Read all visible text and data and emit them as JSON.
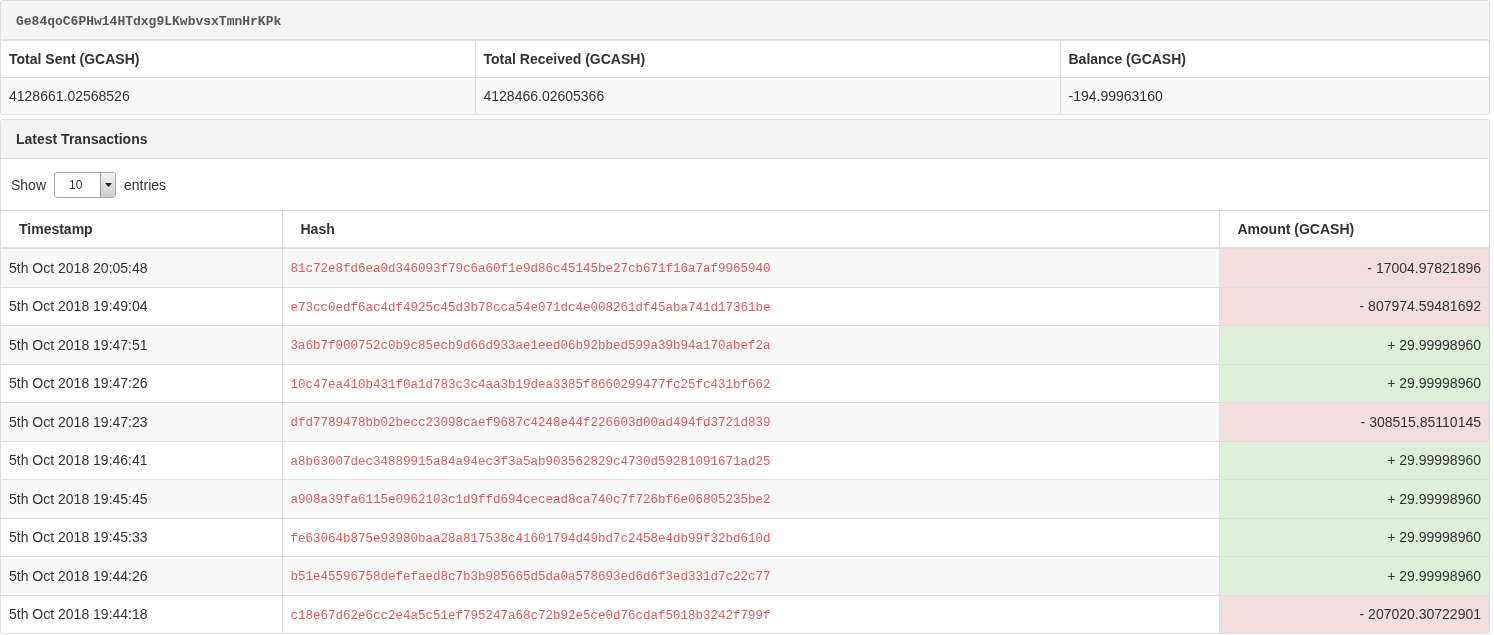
{
  "address": "Ge84qoC6PHw14HTdxg9LKwbvsxTmnHrKPk",
  "summary": {
    "columns": [
      "Total Sent (GCASH)",
      "Total Received (GCASH)",
      "Balance (GCASH)"
    ],
    "values": [
      "4128661.02568526",
      "4128466.02605366",
      "-194.99963160"
    ]
  },
  "transactions": {
    "title": "Latest Transactions",
    "show_label": "Show",
    "page_size": "10",
    "entries_label": "entries",
    "columns": [
      "Timestamp",
      "Hash",
      "Amount (GCASH)"
    ],
    "rows": [
      {
        "timestamp": "5th Oct 2018 20:05:48",
        "hash": "81c72e8fd6ea0d346093f79c6a60f1e9d86c45145be27cb671f16a7af9965940",
        "amount": "- 17004.97821896",
        "kind": "sent"
      },
      {
        "timestamp": "5th Oct 2018 19:49:04",
        "hash": "e73cc0edf6ac4df4925c45d3b78cca54e071dc4e008261df45aba741d17361be",
        "amount": "- 807974.59481692",
        "kind": "sent"
      },
      {
        "timestamp": "5th Oct 2018 19:47:51",
        "hash": "3a6b7f000752c0b9c85ecb9d66d933ae1eed06b92bbed599a39b94a170abef2a",
        "amount": "+ 29.99998960",
        "kind": "received"
      },
      {
        "timestamp": "5th Oct 2018 19:47:26",
        "hash": "10c47ea410b431f0a1d783c3c4aa3b19dea3385f8660299477fc25fc431bf662",
        "amount": "+ 29.99998960",
        "kind": "received"
      },
      {
        "timestamp": "5th Oct 2018 19:47:23",
        "hash": "dfd7789478bb02becc23098caef9687c4248e44f226603d00ad494fd3721d839",
        "amount": "- 308515.85110145",
        "kind": "sent"
      },
      {
        "timestamp": "5th Oct 2018 19:46:41",
        "hash": "a8b63007dec34889915a84a94ec3f3a5ab903562829c4730d59281091671ad25",
        "amount": "+ 29.99998960",
        "kind": "received"
      },
      {
        "timestamp": "5th Oct 2018 19:45:45",
        "hash": "a908a39fa6115e0962103c1d9ffd694cecead8ca740c7f726bf6e06805235be2",
        "amount": "+ 29.99998960",
        "kind": "received"
      },
      {
        "timestamp": "5th Oct 2018 19:45:33",
        "hash": "fe63064b875e93980baa28a817538c41601794d49bd7c2458e4db99f32bd610d",
        "amount": "+ 29.99998960",
        "kind": "received"
      },
      {
        "timestamp": "5th Oct 2018 19:44:26",
        "hash": "b51e45596758defefaed8c7b3b985665d5da0a578693ed6d6f3ed331d7c22c77",
        "amount": "+ 29.99998960",
        "kind": "received"
      },
      {
        "timestamp": "5th Oct 2018 19:44:18",
        "hash": "c18e67d62e6cc2e4a5c51ef795247a68c72b92e5ce0d76cdaf5018b3242f799f",
        "amount": "- 207020.30722901",
        "kind": "sent"
      }
    ]
  }
}
